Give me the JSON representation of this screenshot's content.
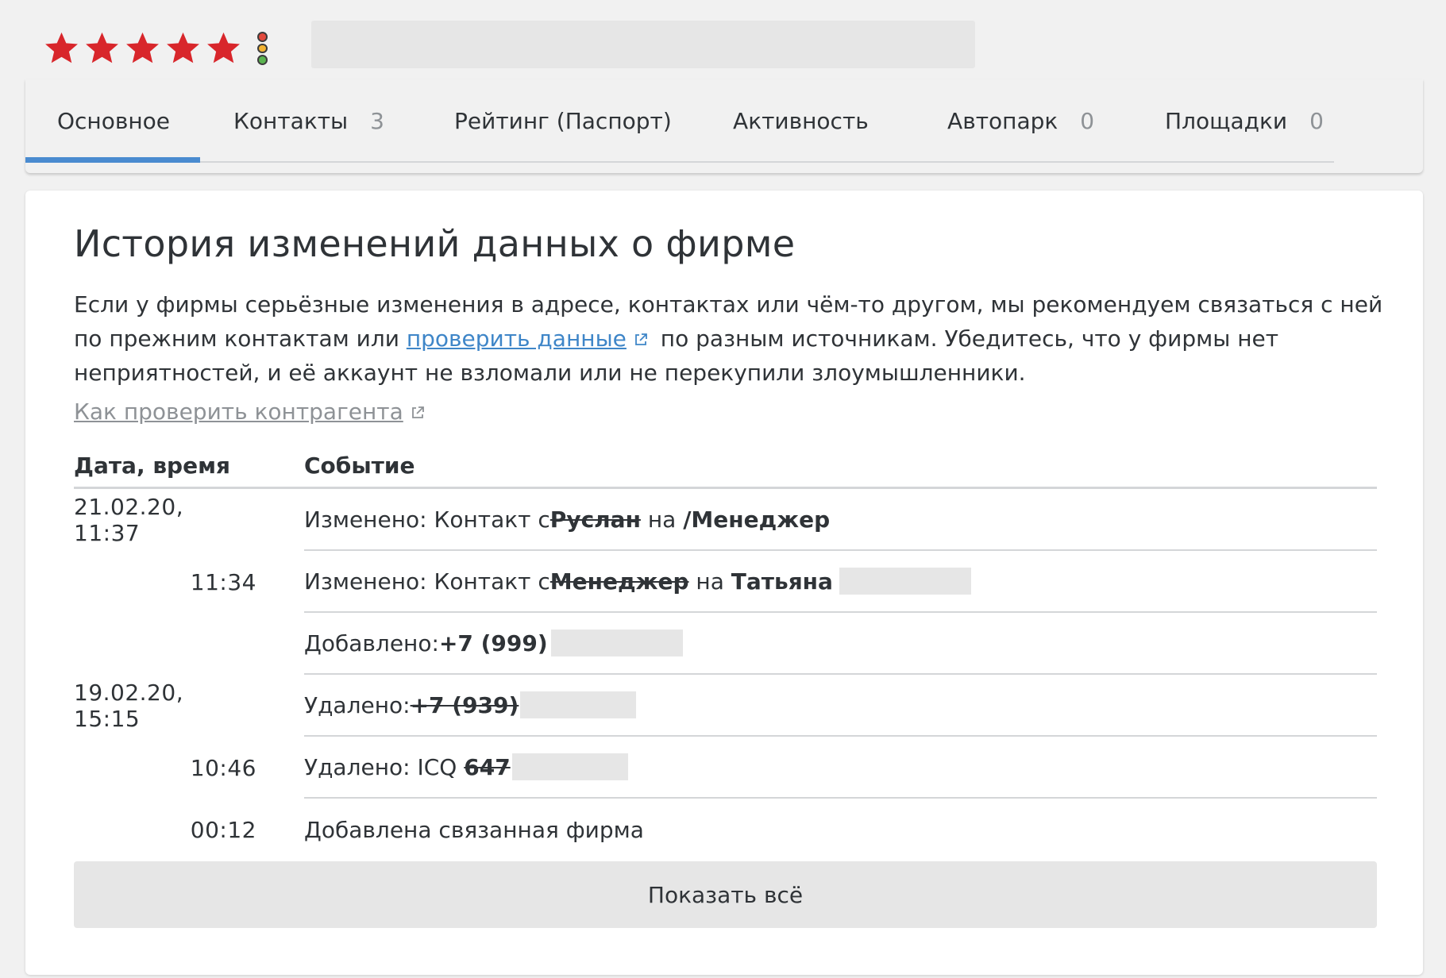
{
  "rating": {
    "stars": 5,
    "max": 5,
    "star_color": "#d8262b"
  },
  "traffic_light": {
    "colors": [
      "#e24a3d",
      "#f3b332",
      "#5bb450"
    ]
  },
  "tabs": [
    {
      "label": "Основное",
      "count": "",
      "active": true
    },
    {
      "label": "Контакты",
      "count": "3"
    },
    {
      "label": "Рейтинг (Паспорт)",
      "count": ""
    },
    {
      "label": "Активность",
      "count": ""
    },
    {
      "label": "Автопарк",
      "count": "0"
    },
    {
      "label": "Площадки",
      "count": "0"
    }
  ],
  "accent_color": "#4a8bd0",
  "history": {
    "title": "История изменений данных о фирме",
    "lead_before_link": "Если у фирмы серьёзные изменения в адресе, контактах или чём-то другом, мы рекомендуем связаться с ней по прежним контактам или ",
    "lead_link": "проверить данные",
    "lead_after_link": " по разным источникам. Убедитесь, что у фирмы нет неприятностей, и её аккаунт не взломали или не перекупили злоумышленники.",
    "howto_link": "Как проверить контрагента",
    "columns": {
      "date": "Дата, время",
      "event": "Событие"
    },
    "rows": [
      {
        "date": "21.02.20, 11:37",
        "prefix": "Изменено: Контакт с ",
        "old": "Руслан",
        "mid": " на ",
        "new": "/Менеджер"
      },
      {
        "date": "11:34",
        "prefix": "Изменено: Контакт с ",
        "old": "Менеджер",
        "mid": " на ",
        "new": "Татьяна"
      },
      {
        "date": "",
        "prefix": "Добавлено: ",
        "new": "+7 (999)"
      },
      {
        "date": "19.02.20, 15:15",
        "prefix": "Удалено: ",
        "old": "+7 (939)"
      },
      {
        "date": "10:46",
        "prefix": "Удалено: ICQ ",
        "old": "647"
      },
      {
        "date": "00:12",
        "prefix": "Добавлена связанная фирма"
      }
    ],
    "show_all": "Показать всё"
  }
}
